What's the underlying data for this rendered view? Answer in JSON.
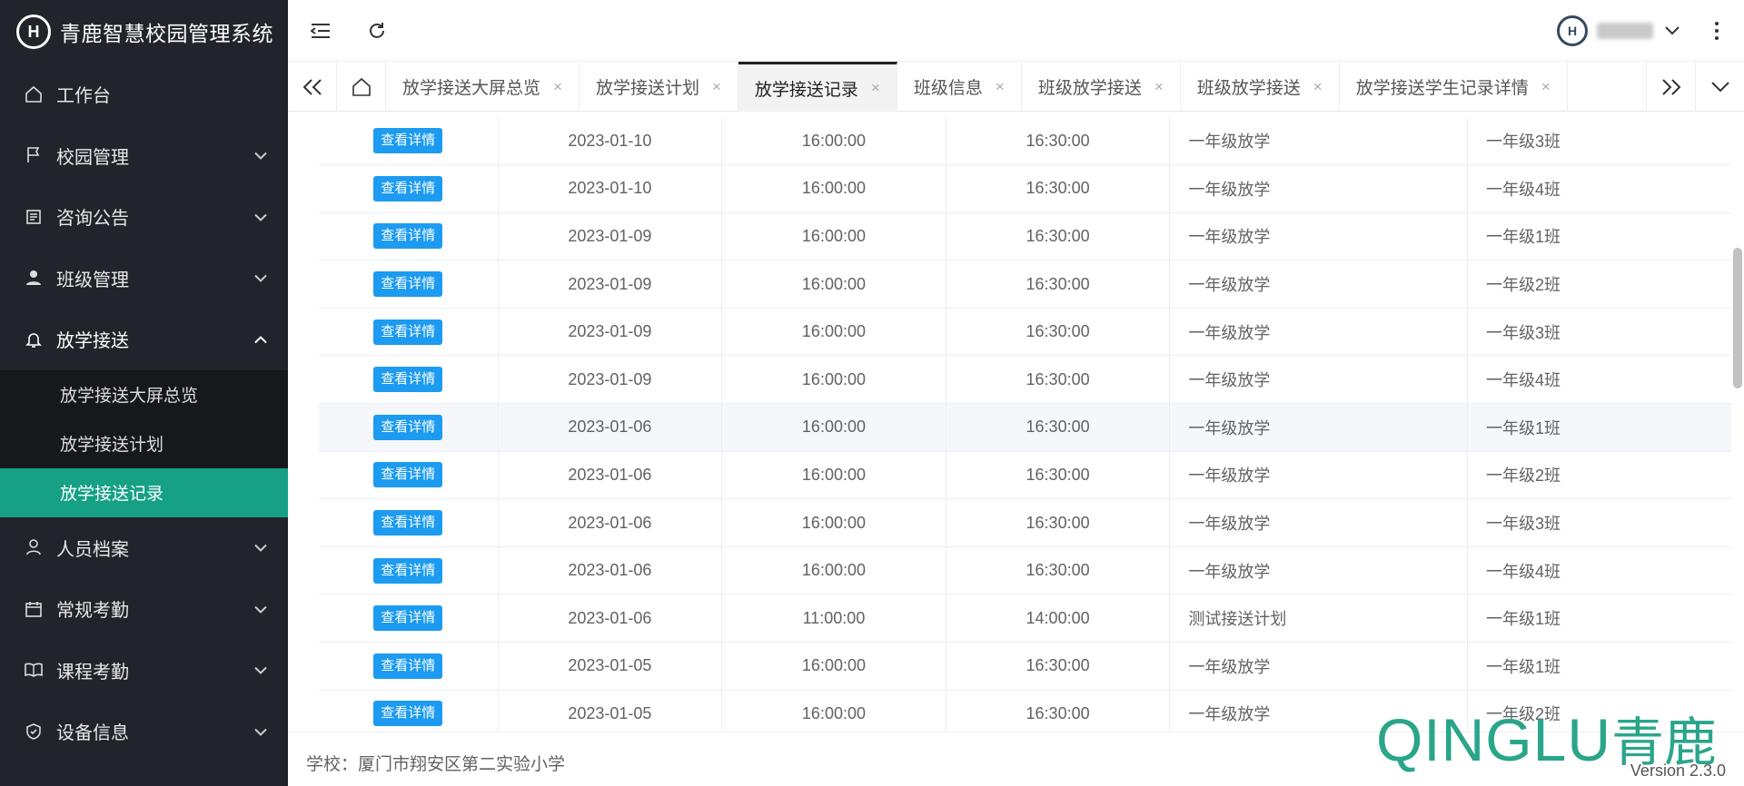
{
  "app": {
    "title": "青鹿智慧校园管理系统",
    "logo_letter": "H"
  },
  "sidebar": {
    "items": [
      {
        "label": "工作台",
        "icon": "home-icon",
        "has_children": false
      },
      {
        "label": "校园管理",
        "icon": "flag-icon",
        "has_children": true
      },
      {
        "label": "咨询公告",
        "icon": "news-icon",
        "has_children": true
      },
      {
        "label": "班级管理",
        "icon": "user-icon",
        "has_children": true
      },
      {
        "label": "放学接送",
        "icon": "bell-icon",
        "has_children": true,
        "open": true,
        "children": [
          {
            "label": "放学接送大屏总览"
          },
          {
            "label": "放学接送计划"
          },
          {
            "label": "放学接送记录",
            "active": true
          }
        ]
      },
      {
        "label": "人员档案",
        "icon": "person-icon",
        "has_children": true
      },
      {
        "label": "常规考勤",
        "icon": "calendar-icon",
        "has_children": true
      },
      {
        "label": "课程考勤",
        "icon": "book-icon",
        "has_children": true
      },
      {
        "label": "设备信息",
        "icon": "shield-icon",
        "has_children": true
      }
    ]
  },
  "tabs": [
    {
      "label": "放学接送大屏总览"
    },
    {
      "label": "放学接送计划"
    },
    {
      "label": "放学接送记录",
      "active": true
    },
    {
      "label": "班级信息"
    },
    {
      "label": "班级放学接送"
    },
    {
      "label": "班级放学接送"
    },
    {
      "label": "放学接送学生记录详情"
    }
  ],
  "table": {
    "button_label": "查看详情",
    "rows": [
      {
        "date": "2023-01-10",
        "start": "16:00:00",
        "end": "16:30:00",
        "name": "一年级放学",
        "class": "一年级3班"
      },
      {
        "date": "2023-01-10",
        "start": "16:00:00",
        "end": "16:30:00",
        "name": "一年级放学",
        "class": "一年级4班"
      },
      {
        "date": "2023-01-09",
        "start": "16:00:00",
        "end": "16:30:00",
        "name": "一年级放学",
        "class": "一年级1班"
      },
      {
        "date": "2023-01-09",
        "start": "16:00:00",
        "end": "16:30:00",
        "name": "一年级放学",
        "class": "一年级2班"
      },
      {
        "date": "2023-01-09",
        "start": "16:00:00",
        "end": "16:30:00",
        "name": "一年级放学",
        "class": "一年级3班"
      },
      {
        "date": "2023-01-09",
        "start": "16:00:00",
        "end": "16:30:00",
        "name": "一年级放学",
        "class": "一年级4班"
      },
      {
        "date": "2023-01-06",
        "start": "16:00:00",
        "end": "16:30:00",
        "name": "一年级放学",
        "class": "一年级1班",
        "highlight": true
      },
      {
        "date": "2023-01-06",
        "start": "16:00:00",
        "end": "16:30:00",
        "name": "一年级放学",
        "class": "一年级2班"
      },
      {
        "date": "2023-01-06",
        "start": "16:00:00",
        "end": "16:30:00",
        "name": "一年级放学",
        "class": "一年级3班"
      },
      {
        "date": "2023-01-06",
        "start": "16:00:00",
        "end": "16:30:00",
        "name": "一年级放学",
        "class": "一年级4班"
      },
      {
        "date": "2023-01-06",
        "start": "11:00:00",
        "end": "14:00:00",
        "name": "测试接送计划",
        "class": "一年级1班"
      },
      {
        "date": "2023-01-05",
        "start": "16:00:00",
        "end": "16:30:00",
        "name": "一年级放学",
        "class": "一年级1班"
      },
      {
        "date": "2023-01-05",
        "start": "16:00:00",
        "end": "16:30:00",
        "name": "一年级放学",
        "class": "一年级2班"
      }
    ]
  },
  "footer": {
    "school": "学校：厦门市翔安区第二实验小学",
    "brand_en": "QINGLU",
    "brand_cn": "青鹿",
    "version": "Version 2.3.0"
  },
  "colors": {
    "sidebar_bg": "#22242b",
    "active": "#16a085",
    "button": "#1c9bf0",
    "brand": "#2aa58a"
  }
}
